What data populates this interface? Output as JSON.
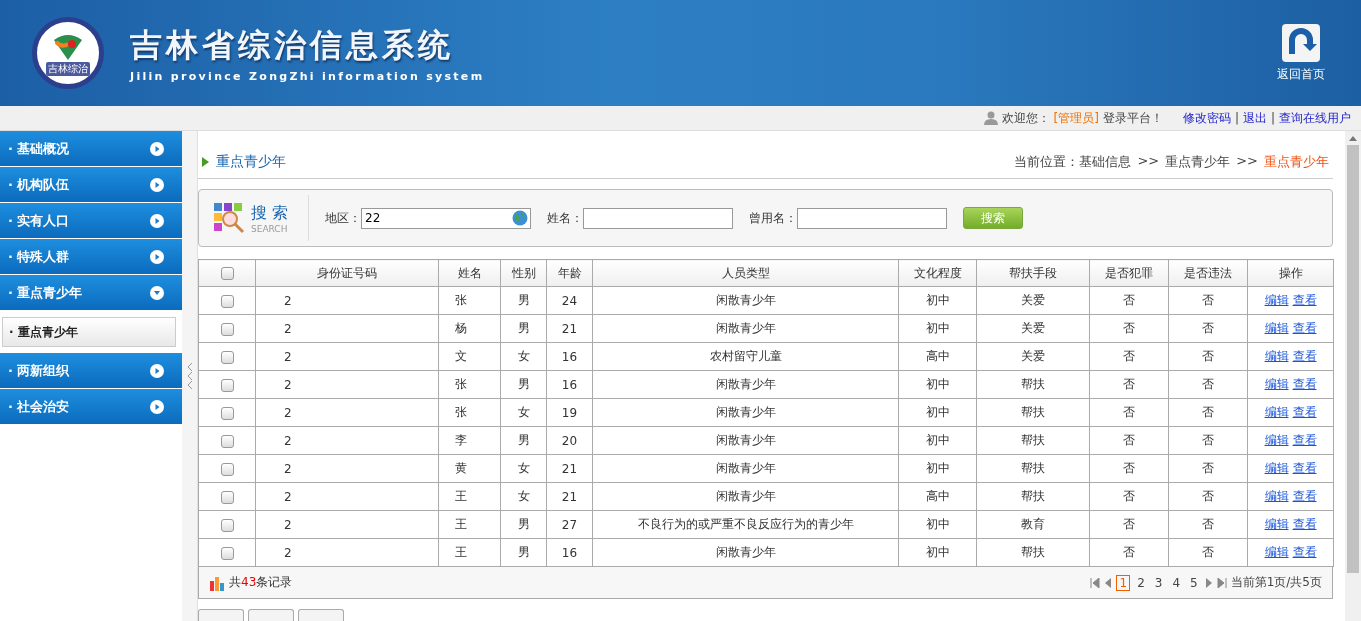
{
  "header": {
    "logo_text": "吉林综治",
    "title": "吉林省综治信息系统",
    "subtitle": "Jilin province ZongZhi information system",
    "home_button": "返回首页"
  },
  "user_bar": {
    "welcome": "欢迎您：",
    "role": "[管理员]",
    "after": "登录平台！",
    "links": [
      "修改密码",
      "退出",
      "查询在线用户"
    ],
    "separator": "|"
  },
  "sidebar": {
    "items": [
      {
        "label": "· 基础概况",
        "expanded": false
      },
      {
        "label": "· 机构队伍",
        "expanded": false
      },
      {
        "label": "· 实有人口",
        "expanded": false
      },
      {
        "label": "· 特殊人群",
        "expanded": false
      },
      {
        "label": "· 重点青少年",
        "expanded": true,
        "children": [
          {
            "label": "· 重点青少年",
            "selected": true
          }
        ]
      },
      {
        "label": "· 两新组织",
        "expanded": false
      },
      {
        "label": "· 社会治安",
        "expanded": false
      }
    ]
  },
  "page": {
    "title": "重点青少年",
    "breadcrumb": [
      "当前位置：基础信息",
      ">>",
      "重点青少年",
      ">>",
      "重点青少年"
    ]
  },
  "search": {
    "title": "搜 索",
    "subtitle": "SEARCH",
    "fields": [
      {
        "label": "地区：",
        "value": "22",
        "kind": "region"
      },
      {
        "label": "姓名：",
        "kind": "text"
      },
      {
        "label": "曾用名：",
        "kind": "text"
      }
    ],
    "button": "搜索"
  },
  "table": {
    "select_all": {
      "checked": false
    },
    "columns": [
      "身份证号码",
      "姓名",
      "性别",
      "年龄",
      "人员类型",
      "文化程度",
      "帮扶手段",
      "是否犯罪",
      "是否违法",
      "操作"
    ],
    "rows": [
      {
        "checked": false,
        "cells": [
          "2",
          "张",
          "男",
          "24",
          "闲散青少年",
          "初中",
          "关爱",
          "否",
          "否"
        ],
        "actions": [
          "编辑",
          "查看"
        ]
      },
      {
        "checked": false,
        "cells": [
          "2",
          "杨",
          "男",
          "21",
          "闲散青少年",
          "初中",
          "关爱",
          "否",
          "否"
        ],
        "actions": [
          "编辑",
          "查看"
        ]
      },
      {
        "checked": false,
        "cells": [
          "2",
          "文",
          "女",
          "16",
          "农村留守儿童",
          "高中",
          "关爱",
          "否",
          "否"
        ],
        "actions": [
          "编辑",
          "查看"
        ]
      },
      {
        "checked": false,
        "cells": [
          "2",
          "张",
          "男",
          "16",
          "闲散青少年",
          "初中",
          "帮扶",
          "否",
          "否"
        ],
        "actions": [
          "编辑",
          "查看"
        ]
      },
      {
        "checked": false,
        "cells": [
          "2",
          "张",
          "女",
          "19",
          "闲散青少年",
          "初中",
          "帮扶",
          "否",
          "否"
        ],
        "actions": [
          "编辑",
          "查看"
        ]
      },
      {
        "checked": false,
        "cells": [
          "2",
          "李",
          "男",
          "20",
          "闲散青少年",
          "初中",
          "帮扶",
          "否",
          "否"
        ],
        "actions": [
          "编辑",
          "查看"
        ]
      },
      {
        "checked": false,
        "cells": [
          "2",
          "黄",
          "女",
          "21",
          "闲散青少年",
          "初中",
          "帮扶",
          "否",
          "否"
        ],
        "actions": [
          "编辑",
          "查看"
        ]
      },
      {
        "checked": false,
        "cells": [
          "2",
          "王",
          "女",
          "21",
          "闲散青少年",
          "高中",
          "帮扶",
          "否",
          "否"
        ],
        "actions": [
          "编辑",
          "查看"
        ]
      },
      {
        "checked": false,
        "cells": [
          "2",
          "王",
          "男",
          "27",
          "不良行为的或严重不良反应行为的青少年",
          "初中",
          "教育",
          "否",
          "否"
        ],
        "actions": [
          "编辑",
          "查看"
        ]
      },
      {
        "checked": false,
        "cells": [
          "2",
          "王",
          "男",
          "16",
          "闲散青少年",
          "初中",
          "帮扶",
          "否",
          "否"
        ],
        "actions": [
          "编辑",
          "查看"
        ]
      }
    ]
  },
  "footer": {
    "total_prefix": "共",
    "total_count": "43",
    "total_suffix": "条记录",
    "pages": [
      {
        "label": "1",
        "selected": true
      },
      {
        "label": "2",
        "selected": false
      },
      {
        "label": "3",
        "selected": false
      },
      {
        "label": "4",
        "selected": false
      },
      {
        "label": "5",
        "selected": false
      }
    ],
    "page_info": "当前第1页/共5页"
  }
}
